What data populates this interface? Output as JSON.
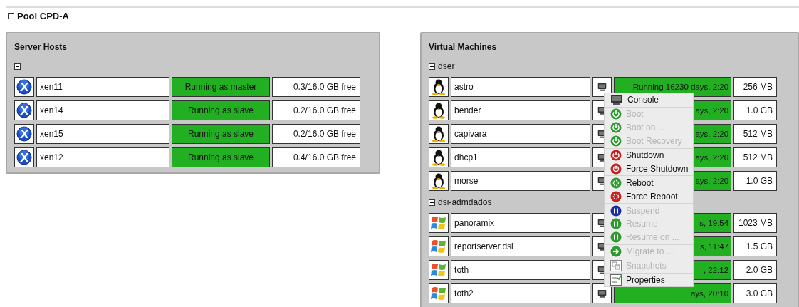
{
  "pool": {
    "title": "Pool CPD-A",
    "expanded": true
  },
  "server_hosts": {
    "title": "Server Hosts",
    "expanded": true,
    "hosts": [
      {
        "name": "xen11",
        "status": "Running as master",
        "memory": "0.3/16.0 GB free"
      },
      {
        "name": "xen14",
        "status": "Running as slave",
        "memory": "0.2/16.0 GB free"
      },
      {
        "name": "xen15",
        "status": "Running as slave",
        "memory": "0.2/16.0 GB free"
      },
      {
        "name": "xen12",
        "status": "Running as slave",
        "memory": "0.4/16.0 GB free"
      }
    ]
  },
  "virtual_machines": {
    "title": "Virtual Machines",
    "groups": [
      {
        "name": "dser",
        "expanded": true,
        "vms": [
          {
            "kind": "linux",
            "name": "astro",
            "status": "Running 16230 days, 2:20",
            "memory": "256 MB"
          },
          {
            "kind": "linux",
            "name": "bender",
            "status": "ays, 2:20",
            "memory": "1.0 GB"
          },
          {
            "kind": "linux",
            "name": "capivara",
            "status": "ays, 2:20",
            "memory": "512 MB"
          },
          {
            "kind": "linux",
            "name": "dhcp1",
            "status": "ays, 2:20",
            "memory": "512 MB"
          },
          {
            "kind": "linux",
            "name": "morse",
            "status": "ays, 2:20",
            "memory": "1.0 GB"
          }
        ]
      },
      {
        "name": "dsi-admdados",
        "expanded": true,
        "vms": [
          {
            "kind": "windows",
            "name": "panoramix",
            "status": "s, 19:54",
            "memory": "1023 MB"
          },
          {
            "kind": "windows",
            "name": "reportserver.dsi",
            "status": "s, 11:47",
            "memory": "1.5 GB"
          },
          {
            "kind": "windows",
            "name": "toth",
            "status": ", 22:12",
            "memory": "2.0 GB"
          },
          {
            "kind": "windows",
            "name": "toth2",
            "status": "ays, 20:10",
            "memory": "3.0 GB"
          }
        ]
      }
    ]
  },
  "context_menu": {
    "groups": [
      [
        {
          "kind": "console",
          "label": "Console",
          "disabled": false
        }
      ],
      [
        {
          "kind": "boot",
          "label": "Boot",
          "disabled": true
        },
        {
          "kind": "boot",
          "label": "Boot on ...",
          "disabled": true
        },
        {
          "kind": "boot",
          "label": "Boot Recovery",
          "disabled": true
        }
      ],
      [
        {
          "kind": "shutdown",
          "label": "Shutdown",
          "disabled": false
        },
        {
          "kind": "force-shutdown",
          "label": "Force Shutdown",
          "disabled": false
        }
      ],
      [
        {
          "kind": "reboot",
          "label": "Reboot",
          "disabled": false
        },
        {
          "kind": "force-reboot",
          "label": "Force Reboot",
          "disabled": false
        }
      ],
      [
        {
          "kind": "suspend",
          "label": "Suspend",
          "disabled": true
        },
        {
          "kind": "resume",
          "label": "Resume",
          "disabled": true
        },
        {
          "kind": "resume",
          "label": "Resume on ...",
          "disabled": true
        }
      ],
      [
        {
          "kind": "migrate",
          "label": "Migrate to ...",
          "disabled": true
        }
      ],
      [
        {
          "kind": "snapshots",
          "label": "Snapshots",
          "disabled": true
        }
      ],
      [
        {
          "kind": "properties",
          "label": "Properties",
          "disabled": false
        }
      ]
    ]
  }
}
